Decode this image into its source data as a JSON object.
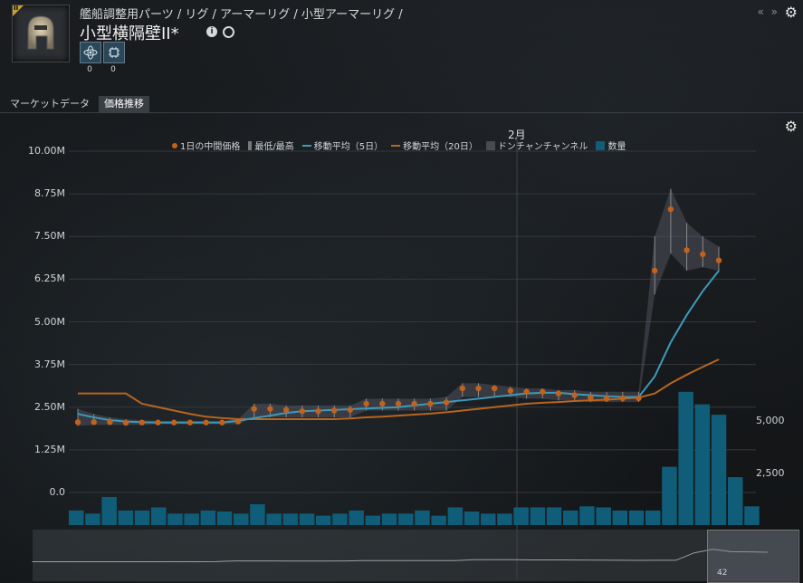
{
  "header": {
    "breadcrumb": "艦船調整用パーツ / リグ / アーマーリグ / 小型アーマーリグ /",
    "title": "小型横隔壁II*",
    "tier_badge": "II",
    "nav_arrows": "« »",
    "skills": [
      {
        "icon": "atom-icon",
        "count": "0"
      },
      {
        "icon": "chip-icon",
        "count": "0"
      }
    ]
  },
  "tabs": [
    {
      "label": "マーケットデータ",
      "active": false
    },
    {
      "label": "価格推移",
      "active": true
    }
  ],
  "chart_data": {
    "type": "line",
    "month_label": "2月",
    "legend": [
      {
        "label": "1日の中間価格",
        "swatch": "dot",
        "color": "#c2621c"
      },
      {
        "label": "最低/最高",
        "swatch": "bar",
        "color": "#7a7a7a"
      },
      {
        "label": "移動平均（5日）",
        "swatch": "line",
        "color": "#3d9ab8"
      },
      {
        "label": "移動平均（20日）",
        "swatch": "line",
        "color": "#b8651f"
      },
      {
        "label": "ドンチャンチャンネル",
        "swatch": "box",
        "color": "#4a4a52"
      },
      {
        "label": "数量",
        "swatch": "box",
        "color": "#0f5d78"
      }
    ],
    "y_ticks": [
      "10.00M",
      "8.75M",
      "7.50M",
      "6.25M",
      "5.00M",
      "3.75M",
      "2.50M",
      "1.25M",
      "0.0"
    ],
    "y_right_ticks": [
      "5,000",
      "2,500"
    ],
    "ylim": [
      0,
      10000000
    ],
    "volume_ylim": [
      0,
      7500
    ],
    "median_price": [
      2.06,
      2.06,
      2.06,
      2.04,
      2.05,
      2.05,
      2.05,
      2.05,
      2.05,
      2.05,
      2.08,
      2.45,
      2.45,
      2.42,
      2.38,
      2.38,
      2.4,
      2.42,
      2.6,
      2.6,
      2.6,
      2.6,
      2.6,
      2.64,
      3.05,
      3.05,
      3.05,
      2.98,
      2.95,
      2.95,
      2.9,
      2.85,
      2.78,
      2.75,
      2.76,
      2.76,
      6.5,
      8.3,
      7.1,
      6.98,
      6.8
    ],
    "ma5": [
      2.3,
      2.2,
      2.12,
      2.08,
      2.06,
      2.05,
      2.05,
      2.05,
      2.05,
      2.05,
      2.1,
      2.18,
      2.25,
      2.33,
      2.38,
      2.4,
      2.42,
      2.44,
      2.46,
      2.48,
      2.5,
      2.55,
      2.6,
      2.65,
      2.7,
      2.75,
      2.8,
      2.85,
      2.9,
      2.92,
      2.92,
      2.88,
      2.85,
      2.82,
      2.8,
      2.8,
      3.4,
      4.4,
      5.2,
      5.9,
      6.5
    ],
    "ma20": [
      2.9,
      2.9,
      2.9,
      2.9,
      2.6,
      2.5,
      2.4,
      2.3,
      2.22,
      2.18,
      2.15,
      2.15,
      2.15,
      2.15,
      2.15,
      2.15,
      2.15,
      2.17,
      2.2,
      2.22,
      2.25,
      2.28,
      2.31,
      2.35,
      2.4,
      2.45,
      2.5,
      2.55,
      2.6,
      2.63,
      2.65,
      2.68,
      2.7,
      2.72,
      2.75,
      2.78,
      2.9,
      3.2,
      3.45,
      3.68,
      3.9
    ],
    "low_high": [
      [
        1.95,
        2.45
      ],
      [
        1.98,
        2.3
      ],
      [
        1.98,
        2.2
      ],
      [
        1.98,
        2.15
      ],
      [
        1.98,
        2.12
      ],
      [
        2.0,
        2.1
      ],
      [
        2.0,
        2.1
      ],
      [
        2.0,
        2.1
      ],
      [
        2.0,
        2.1
      ],
      [
        2.0,
        2.1
      ],
      [
        2.0,
        2.15
      ],
      [
        2.2,
        2.6
      ],
      [
        2.2,
        2.6
      ],
      [
        2.2,
        2.55
      ],
      [
        2.2,
        2.55
      ],
      [
        2.2,
        2.55
      ],
      [
        2.2,
        2.55
      ],
      [
        2.2,
        2.55
      ],
      [
        2.4,
        2.75
      ],
      [
        2.4,
        2.75
      ],
      [
        2.4,
        2.75
      ],
      [
        2.4,
        2.75
      ],
      [
        2.4,
        2.75
      ],
      [
        2.4,
        2.8
      ],
      [
        2.8,
        3.2
      ],
      [
        2.8,
        3.2
      ],
      [
        2.8,
        3.15
      ],
      [
        2.8,
        3.1
      ],
      [
        2.75,
        3.05
      ],
      [
        2.75,
        3.05
      ],
      [
        2.7,
        3.0
      ],
      [
        2.7,
        3.0
      ],
      [
        2.65,
        2.95
      ],
      [
        2.65,
        2.95
      ],
      [
        2.65,
        2.95
      ],
      [
        2.65,
        2.95
      ],
      [
        5.8,
        7.5
      ],
      [
        7.0,
        8.9
      ],
      [
        6.5,
        7.9
      ],
      [
        6.6,
        7.5
      ],
      [
        6.5,
        7.2
      ]
    ],
    "volume": [
      700,
      550,
      1350,
      700,
      700,
      850,
      550,
      550,
      700,
      650,
      550,
      1000,
      550,
      550,
      550,
      450,
      550,
      700,
      450,
      550,
      550,
      700,
      450,
      850,
      650,
      550,
      550,
      850,
      850,
      850,
      700,
      900,
      850,
      700,
      700,
      700,
      2800,
      6400,
      5800,
      5300,
      2300,
      900
    ]
  },
  "navigator": {
    "label": "42"
  }
}
